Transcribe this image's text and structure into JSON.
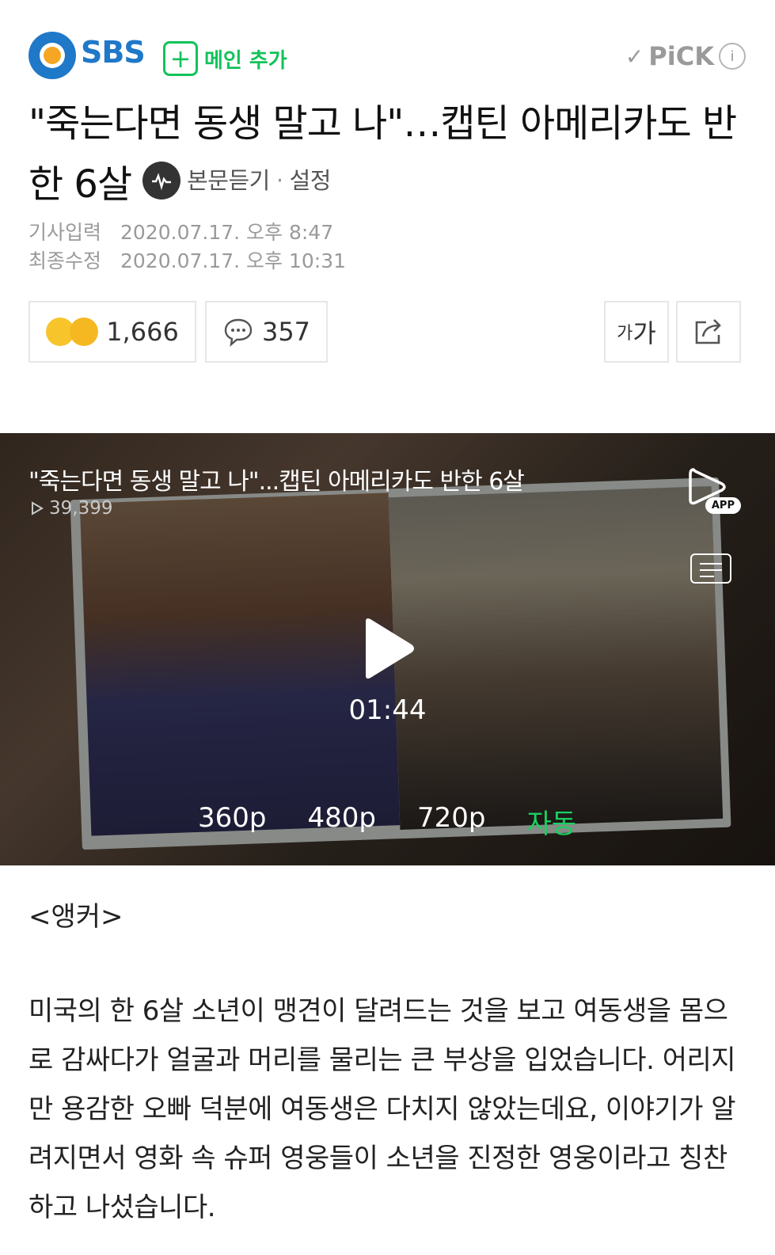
{
  "header": {
    "brand": "SBS",
    "add_main_label": "메인 추가",
    "add_main_icon": "plus-square-icon",
    "pick_label": "PiCK",
    "brand_color": "#1f78c8",
    "accent_color": "#12c35a"
  },
  "article": {
    "title": "\"죽는다면 동생 말고 나\"…캡틴 아메리카도 반한 6살",
    "listen_label": "본문듣기",
    "settings_label": "설정",
    "published_label": "기사입력",
    "published_value": "2020.07.17. 오후 8:47",
    "modified_label": "최종수정",
    "modified_value": "2020.07.17. 오후 10:31"
  },
  "actions": {
    "reactions_count": "1,666",
    "comments_count": "357",
    "font_size_label_small": "가",
    "font_size_label_large": "가"
  },
  "video": {
    "title": "\"죽는다면 동생 말고 나\"...캡틴 아메리카도 반한 6살",
    "views": "39,399",
    "app_badge": "APP",
    "duration": "01:44",
    "qualities": [
      "360p",
      "480p",
      "720p",
      "자동"
    ],
    "selected_quality": "자동"
  },
  "body": {
    "anchor": "<앵커>",
    "paragraph": "미국의 한 6살 소년이 맹견이 달려드는 것을 보고 여동생을 몸으로 감싸다가 얼굴과 머리를 물리는 큰 부상을 입었습니다. 어리지만 용감한 오빠 덕분에 여동생은 다치지 않았는데요, 이야기가 알려지면서 영화 속 슈퍼 영웅들이 소년을 진정한 영웅이라고 칭찬하고 나섰습니다."
  }
}
